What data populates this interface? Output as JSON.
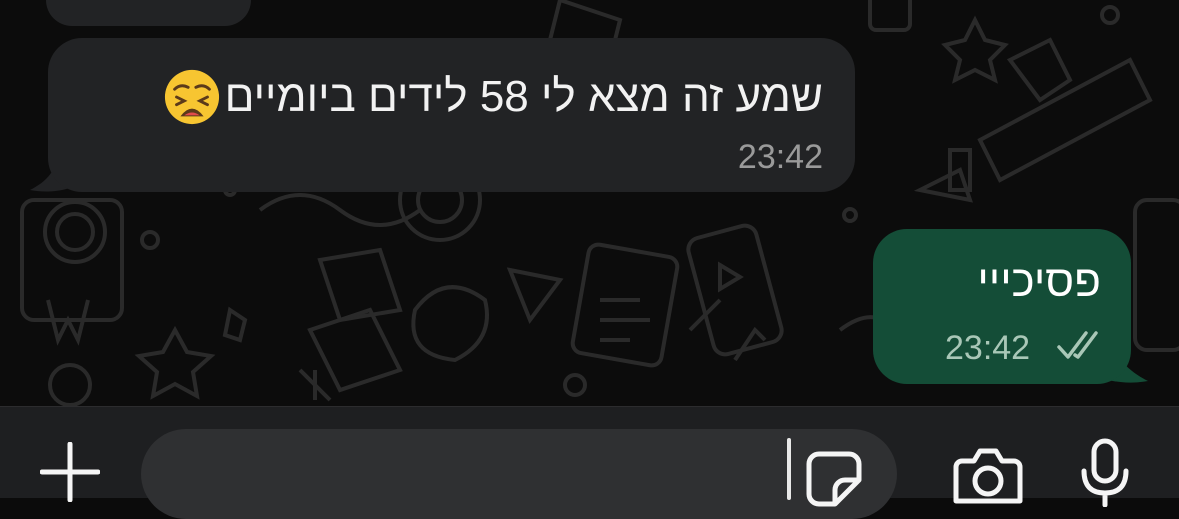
{
  "chat": {
    "messages": [
      {
        "direction": "incoming",
        "text": "שמע זה מצא לי 58 לידים ביומיים",
        "emoji": "weary-face",
        "time": "23:42"
      },
      {
        "direction": "outgoing",
        "text": "פסיכייי",
        "time": "23:42",
        "status": "read"
      }
    ]
  },
  "composer": {
    "input_value": "",
    "icons": [
      "plus-icon",
      "sticker-icon",
      "camera-icon",
      "microphone-icon"
    ]
  },
  "colors": {
    "background": "#0c0c0c",
    "incoming_bubble": "#222325",
    "outgoing_bubble": "#144d37",
    "composer_bar": "#1e1f21",
    "input_field": "#2f3032"
  }
}
